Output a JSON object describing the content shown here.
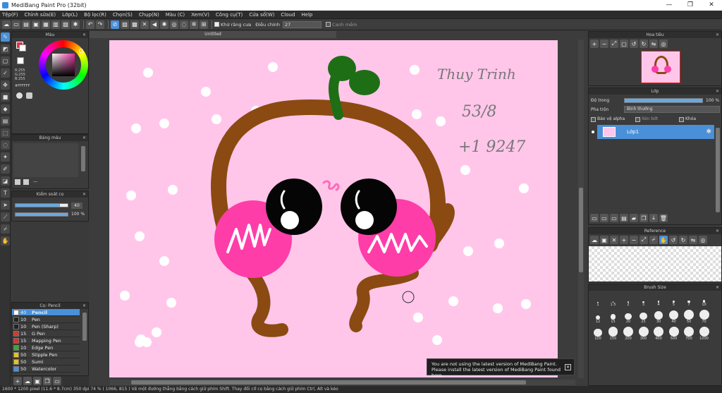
{
  "app": {
    "title": "MediBang Paint Pro (32bit)",
    "controls": [
      "—",
      "❐",
      "✕"
    ]
  },
  "menu": [
    "Tệp(F)",
    "Chỉnh sửa(E)",
    "Lớp(L)",
    "Bộ lọc(R)",
    "Chọn(S)",
    "Chụp(N)",
    "Màu (C)",
    "Xem(V)",
    "Công cụ(T)",
    "Cửa sổ(W)",
    "Cloud",
    "Help"
  ],
  "toolbar": {
    "antialias": "Khử răng cưa",
    "adjust_label": "Điều chỉnh",
    "adjust_value": "27",
    "snap": "Canh mềm"
  },
  "color_panel": {
    "title": "Màu",
    "rgb": [
      "R:255",
      "G:255",
      "B:255"
    ],
    "hex": "#FFFFFF"
  },
  "palette_panel": {
    "title": "Bảng màu",
    "dots": "---"
  },
  "brush_control": {
    "title": "Kiểm soát cọ",
    "size": "40",
    "opacity": "100 %",
    "size_fill": 0.85,
    "opacity_fill": 1.0
  },
  "brush_list": {
    "title": "Cọ: Pencil",
    "items": [
      {
        "size": "40",
        "name": "Pencil",
        "color": "#ffffff",
        "selected": true
      },
      {
        "size": "10",
        "name": "Pen",
        "color": "#222222",
        "selected": false
      },
      {
        "size": "10",
        "name": "Pen (Sharp)",
        "color": "#222222",
        "selected": false
      },
      {
        "size": "15",
        "name": "G Pen",
        "color": "#d9342b",
        "selected": false
      },
      {
        "size": "15",
        "name": "Mapping Pen",
        "color": "#d9342b",
        "selected": false
      },
      {
        "size": "10",
        "name": "Edge Pen",
        "color": "#3aa935",
        "selected": false
      },
      {
        "size": "50",
        "name": "Stipple Pen",
        "color": "#e8c020",
        "selected": false
      },
      {
        "size": "50",
        "name": "Sumi",
        "color": "#e8c020",
        "selected": false
      },
      {
        "size": "50",
        "name": "Watercolor",
        "color": "#4a90d9",
        "selected": false
      }
    ]
  },
  "canvas": {
    "tab": "Untitled",
    "bg": "#ffc6ea",
    "handwriting": [
      "Thuy Trinh",
      "53/8",
      "+1 9247"
    ]
  },
  "navigator": {
    "title": "Hoa tiêu"
  },
  "layer_panel": {
    "title": "Lớp",
    "opacity_label": "Độ trong",
    "opacity_value": "100 %",
    "blend_label": "Pha trộn",
    "blend_value": "Bình thường",
    "protect_alpha": "Bảo vệ alpha",
    "clipping": "Xén bớt",
    "lock": "Khóa",
    "layer_name": "Lớp1"
  },
  "reference": {
    "title": "Reference"
  },
  "brush_size": {
    "title": "Brush Size",
    "sizes": [
      "1",
      "1.5",
      "2",
      "3",
      "4",
      "5",
      "7",
      "10",
      "12",
      "15",
      "20",
      "25",
      "30",
      "40",
      "50",
      "70",
      "100",
      "150",
      "200",
      "300",
      "400",
      "500",
      "700",
      "1000"
    ]
  },
  "notice": {
    "line1": "You are not using the latest version of MediBang Paint.",
    "line2": "Please install the latest version of MediBang Paint found here.",
    "close": "✕"
  },
  "status": "1600 * 1200 pixel  (11.6 * 8.7cm)  350 dpi  74 %  ( 1066, 815 )  Vẽ một đường thẳng bằng cách giữ phím Shift. Thay đổi cỡ cọ bằng cách giữ phím Ctrl, Alt và kéo"
}
